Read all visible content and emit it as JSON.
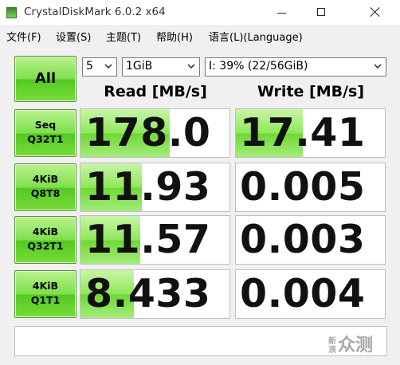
{
  "window": {
    "title": "CrystalDiskMark 6.0.2 x64",
    "icon": "crystaldiskmark-app-icon"
  },
  "menu": [
    {
      "label": "文件(F)"
    },
    {
      "label": "设置(S)"
    },
    {
      "label": "主题(T)"
    },
    {
      "label": "帮助(H)"
    },
    {
      "label": "语言(L)(Language)"
    }
  ],
  "controls": {
    "all_label": "All",
    "count": "5",
    "size": "1GiB",
    "drive": "I: 39% (22/56GiB)"
  },
  "columns": {
    "read": "Read [MB/s]",
    "write": "Write [MB/s]"
  },
  "tests": [
    {
      "label_line1": "Seq",
      "label_line2": "Q32T1",
      "read": "178.0",
      "write": "17.41",
      "read_fill": 0.6,
      "write_fill": 0.45
    },
    {
      "label_line1": "4KiB",
      "label_line2": "Q8T8",
      "read": "11.93",
      "write": "0.005",
      "read_fill": 0.41,
      "write_fill": 0.0
    },
    {
      "label_line1": "4KiB",
      "label_line2": "Q32T1",
      "read": "11.57",
      "write": "0.003",
      "read_fill": 0.4,
      "write_fill": 0.0
    },
    {
      "label_line1": "4KiB",
      "label_line2": "Q1T1",
      "read": "8.433",
      "write": "0.004",
      "read_fill": 0.36,
      "write_fill": 0.0
    }
  ],
  "comment": "",
  "watermark": {
    "small_top": "新",
    "small_bottom": "浪",
    "text": "众测"
  },
  "colors": {
    "bar_green": "#7fdf4c",
    "button_green": "#54c920"
  }
}
